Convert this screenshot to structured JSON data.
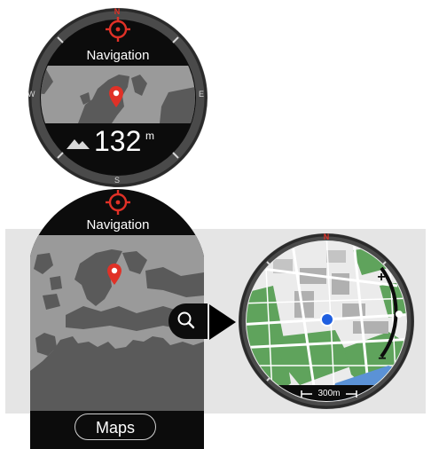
{
  "watch_face": {
    "header_title": "Navigation",
    "compass": {
      "north": "N",
      "south": "S",
      "east": "E",
      "west": "W"
    },
    "altitude_value": "132",
    "altitude_unit": "m",
    "icons": [
      "crosshair-icon",
      "location-pin-icon",
      "mountain-icon"
    ]
  },
  "nav_screen": {
    "header_title": "Navigation",
    "maps_button_label": "Maps",
    "icons": [
      "crosshair-icon",
      "location-pin-icon",
      "zoom-magnifier-icon"
    ]
  },
  "map_view": {
    "north_marker": "N",
    "zoom_in_label": "+",
    "zoom_out_label": "−",
    "scale_label": "300m",
    "icons": [
      "arrow-right-icon",
      "current-location-dot-icon"
    ]
  },
  "colors": {
    "bezel": "#4a4a4a",
    "screen_black": "#0c0c0c",
    "map_land_grey": "#5a5a5a",
    "accent_red": "#e03127",
    "park_green": "#5fa35c",
    "water_blue": "#5b92d6",
    "location_blue": "#1f5fe0"
  }
}
